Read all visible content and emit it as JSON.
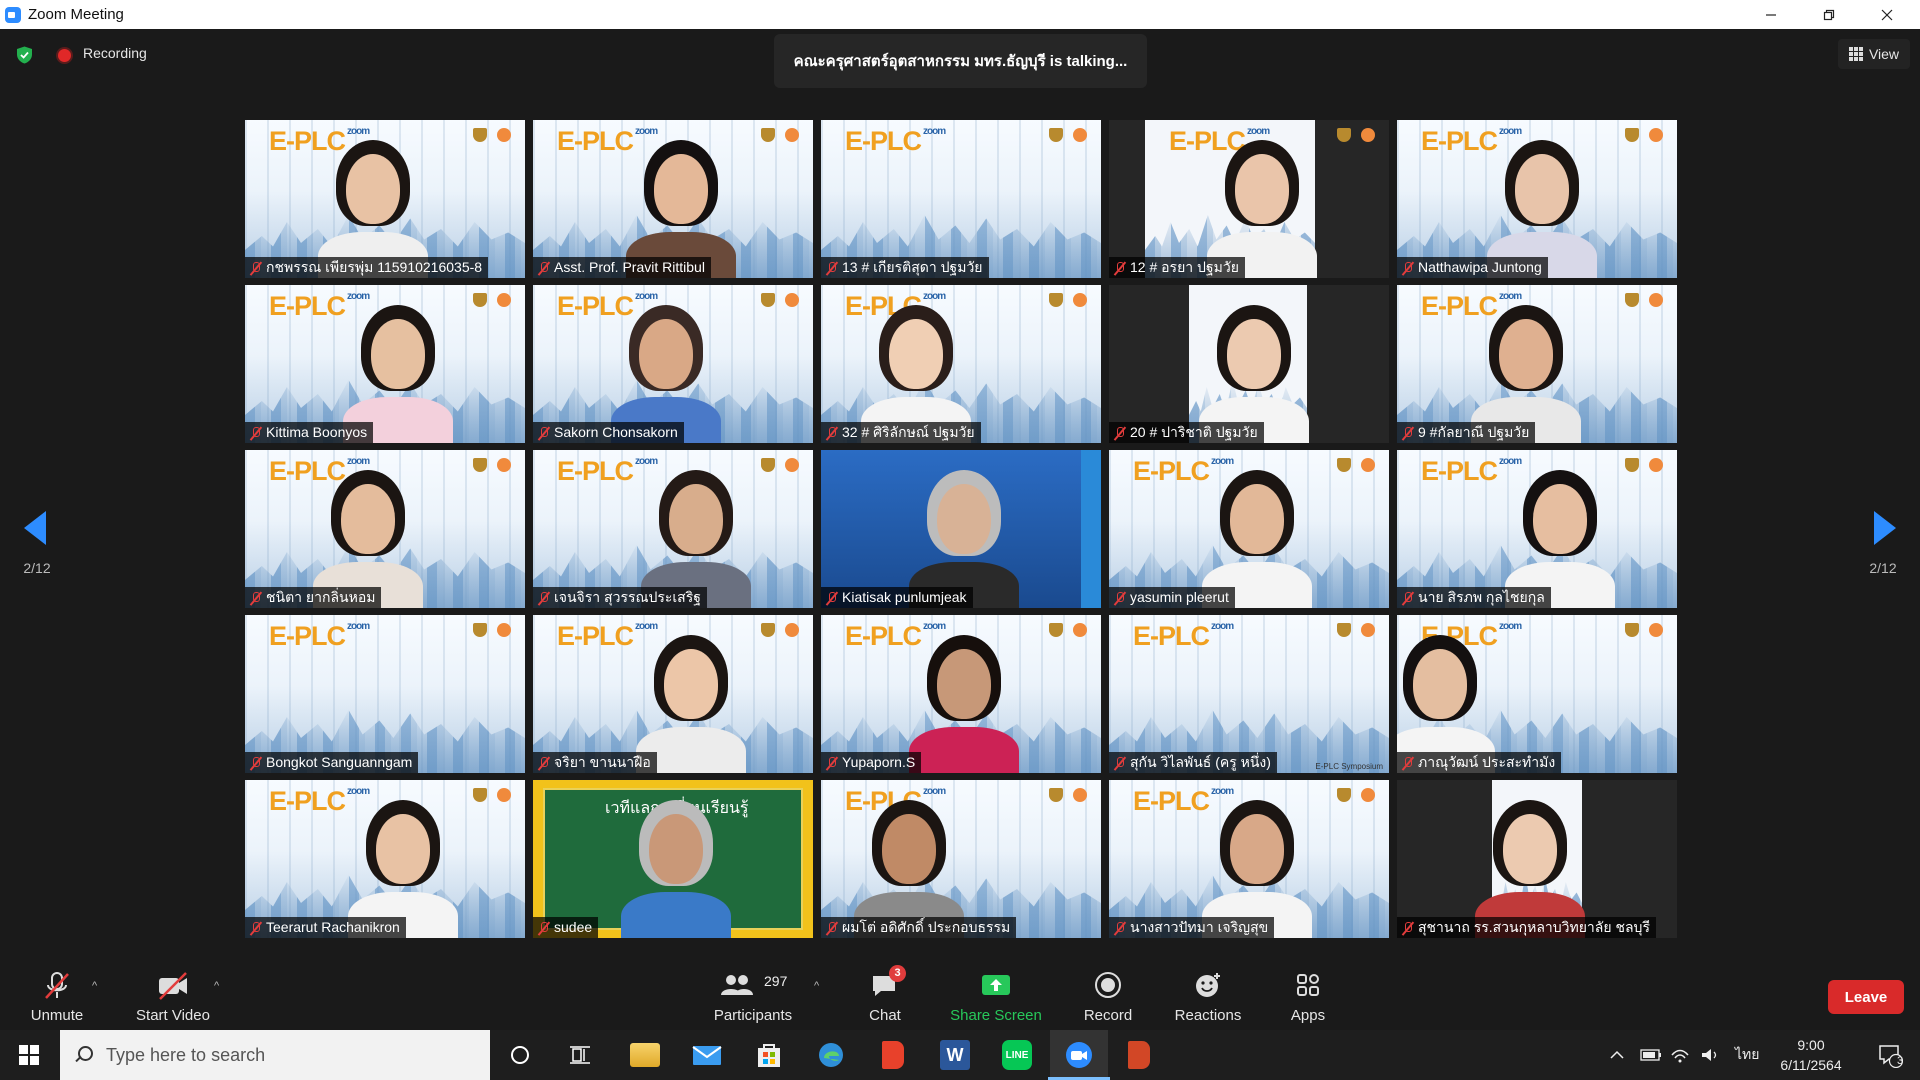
{
  "window": {
    "title": "Zoom Meeting"
  },
  "topbar": {
    "recording_label": "Recording",
    "talking": "คณะครุศาสตร์อุตสาหกรรม มทร.ธัญบุรี is talking...",
    "view_label": "View",
    "page_left": "2/12",
    "page_right": "2/12"
  },
  "participants": [
    {
      "name": "กชพรรณ เพียรพุ่ม 115910216035-8"
    },
    {
      "name": "Asst. Prof. Pravit Rittibul"
    },
    {
      "name": "13 # เกียรติสุดา ปฐมวัย"
    },
    {
      "name": "12 # อรยา ปฐมวัย"
    },
    {
      "name": "Natthawipa Juntong"
    },
    {
      "name": "Kittima Boonyos"
    },
    {
      "name": "Sakorn Chonsakorn"
    },
    {
      "name": "32 # ศิริลักษณ์ ปฐมวัย"
    },
    {
      "name": "20 # ปาริชาติ ปฐมวัย"
    },
    {
      "name": "9 #กัลยาณี ปฐมวัย"
    },
    {
      "name": "ชนิตา ยากลิ่นหอม"
    },
    {
      "name": "เจนจิรา สุวรรณประเสริฐ"
    },
    {
      "name": "Kiatisak punlumjeak"
    },
    {
      "name": "yasumin pleerut"
    },
    {
      "name": "นาย สิรภพ กุลไชยกุล"
    },
    {
      "name": "Bongkot Sanguanngam"
    },
    {
      "name": "จริยา ขานนาฝือ"
    },
    {
      "name": "Yupaporn.S"
    },
    {
      "name": "สุกัน วิไลพันธ์ (ครู หนึ่ง)"
    },
    {
      "name": "ภาณุวัฒน์ ประสะทำมัง"
    },
    {
      "name": "Teerarut Rachanikron"
    },
    {
      "name": "sudee"
    },
    {
      "name": "ผมโต่ อดิศักดิ์ ประกอบธรรม"
    },
    {
      "name": "นางสาวปัทมา เจริญสุข"
    },
    {
      "name": "สุชานาถ รร.สวนกุหลาบวิทยาลัย ชลบุรี"
    }
  ],
  "tile_texts": {
    "plc": "E-PLC",
    "plc_small": "zoom",
    "board_title": "เวทีแลกเปลี่ยนเรียนรู้",
    "symposium": "E-PLC Symposium"
  },
  "toolbar": {
    "unmute": "Unmute",
    "start_video": "Start Video",
    "participants": "Participants",
    "participants_count": "297",
    "chat": "Chat",
    "chat_badge": "3",
    "share_screen": "Share Screen",
    "record": "Record",
    "reactions": "Reactions",
    "apps": "Apps",
    "leave": "Leave"
  },
  "taskbar": {
    "search_placeholder": "Type here to search",
    "lang": "ไทย",
    "time": "9:00",
    "date": "6/11/2564",
    "notif_count": "3"
  },
  "colors": {
    "accent": "#2d8cff",
    "leave": "#d92a2a",
    "share": "#27c85a",
    "muted": "#e23c3c"
  }
}
